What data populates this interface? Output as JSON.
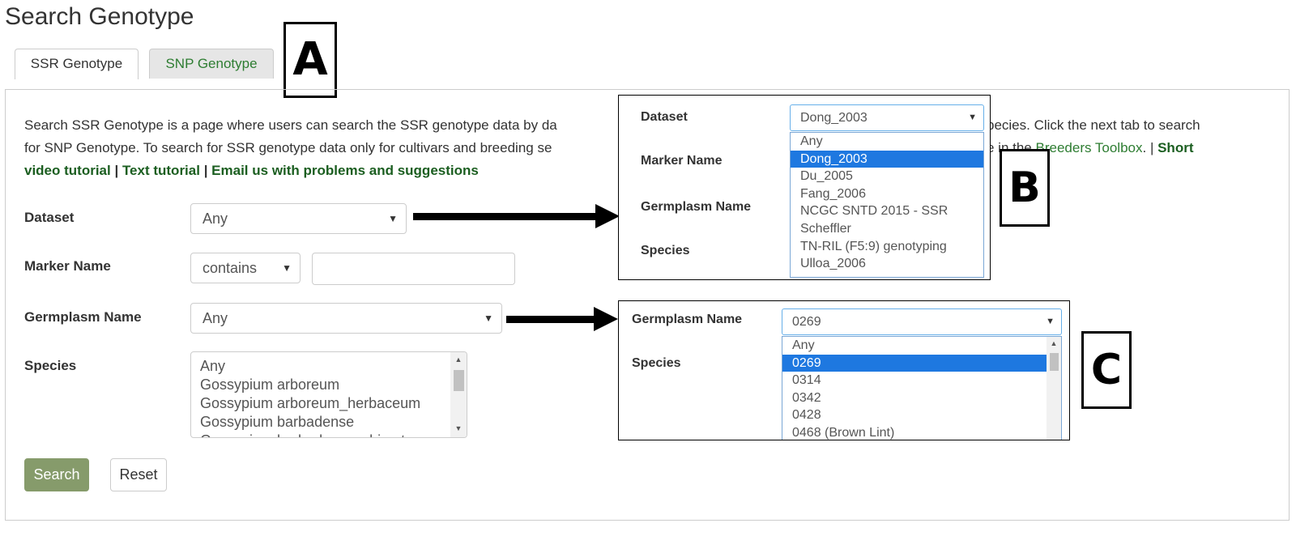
{
  "page_title": "Search Genotype",
  "tabs": [
    {
      "label": "SSR Genotype",
      "active": true
    },
    {
      "label": "SNP Genotype",
      "active": false
    }
  ],
  "annotations": {
    "a": "A",
    "b": "B",
    "c": "C"
  },
  "description": {
    "part1": "Search SSR Genotype is a page where users can search the SSR genotype data by da",
    "part1_end": "pecies. Click the next tab to search",
    "part2": "for SNP Genotype. To search for SSR genotype data only for cultivars and breeding se",
    "part2_end": "e in the ",
    "breeders_link": "Breeders Toolbox",
    "part2_tail": ". | ",
    "short_link_1": "Short",
    "short_link_2": "video tutorial",
    "sep1": " | ",
    "text_tutorial": "Text tutorial",
    "sep2": " | ",
    "email_link": "Email us with problems and suggestions"
  },
  "form": {
    "dataset_label": "Dataset",
    "dataset_value": "Any",
    "marker_label": "Marker Name",
    "marker_operator": "contains",
    "marker_value": "",
    "germplasm_label": "Germplasm Name",
    "germplasm_value": "Any",
    "species_label": "Species",
    "species_options": [
      "Any",
      "Gossypium arboreum",
      "Gossypium arboreum_herbaceum",
      "Gossypium barbadense",
      "Gossypium barbadense x hirsutum"
    ],
    "search_button": "Search",
    "reset_button": "Reset"
  },
  "inset_b": {
    "dataset_label": "Dataset",
    "dataset_value": "Dong_2003",
    "marker_label": "Marker Name",
    "germplasm_label": "Germplasm Name",
    "species_label": "Species",
    "options": [
      "Any",
      "Dong_2003",
      "Du_2005",
      "Fang_2006",
      "NCGC SNTD 2015 - SSR",
      "Scheffler",
      "TN-RIL (F5:9) genotyping",
      "Ulloa_2006"
    ],
    "selected_index": 1
  },
  "inset_c": {
    "germplasm_label": "Germplasm Name",
    "germplasm_value": "0269",
    "species_label": "Species",
    "options": [
      "Any",
      "0269",
      "0314",
      "0342",
      "0428",
      "0468 (Brown Lint)"
    ],
    "selected_index": 1
  },
  "colors": {
    "link_green": "#2e7d32",
    "search_button_bg": "#869b6b",
    "selected_option_bg": "#1e78e0"
  }
}
